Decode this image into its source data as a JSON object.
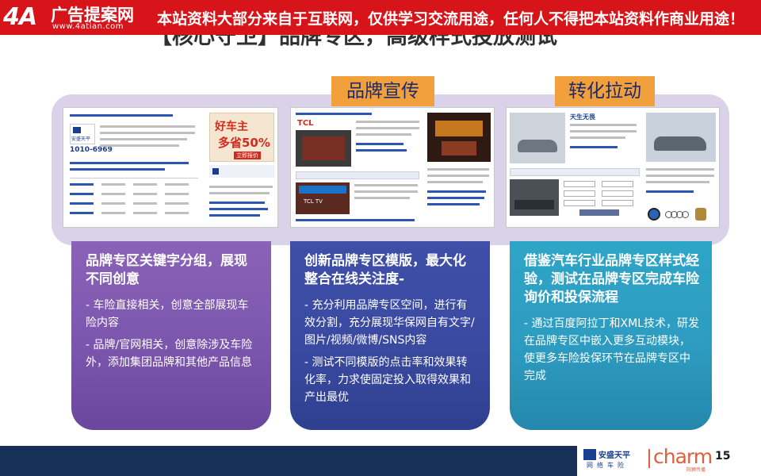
{
  "banner": {
    "logo_mark": "4A",
    "site_name": "广告提案网",
    "site_url": "www.4atian.com",
    "notice": "本站资料大部分来自于互联网，仅供学习交流用途，任何人不得把本站资料作商业用途！"
  },
  "slide": {
    "title": "【核心守卫】品牌专区，高级样式投放测试"
  },
  "tags": {
    "promo": "品牌宣传",
    "convert": "转化拉动"
  },
  "screenshots": {
    "shot1": {
      "brand": "安盛天平",
      "phone": "1010-6969",
      "promo_lines": [
        "好车主",
        "多省50%"
      ],
      "cta": "立即报价"
    },
    "shot2": {
      "brand": "TCL",
      "promo": "TCL TV"
    },
    "shot3": {
      "brand": "天生无畏",
      "car_brands": [
        "Mercedes-Benz",
        "BMW",
        "Audi"
      ]
    }
  },
  "cards": [
    {
      "heading": "品牌专区关键字分组，展现不同创意",
      "paragraphs": [
        "- 车险直接相关，创意全部展现车险内容",
        "- 品牌/官网相关，创意除涉及车险外，添加集团品牌和其他产品信息"
      ]
    },
    {
      "heading": "创新品牌专区模版，最大化整合在线关注度-",
      "paragraphs": [
        " - 充分利用品牌专区空间，进行有效分割，充分展现华保网自有文字/图片/视频/微博/SNS内容",
        "- 测试不同模版的点击率和效果转化率，力求使固定投入取得效果和产出最优"
      ]
    },
    {
      "heading": "借鉴汽车行业品牌专区样式经验，测试在品牌专区完成车险询价和投保流程",
      "paragraphs": [
        "- 通过百度阿拉丁和XML技术，研发在品牌专区中嵌入更多互动模块，使更多车险投保环节在品牌专区中完成"
      ]
    }
  ],
  "footer": {
    "company": "安盛天平",
    "company_sub": "网络车险",
    "agency": "charm",
    "agency_sub": "阳狮传播",
    "page_number": "15"
  },
  "colors": {
    "banner_red": "#d7141a",
    "tag_orange": "#f2a03c",
    "card1_purple": "#7c56ad",
    "card2_blue": "#3a4aa1",
    "card3_teal": "#2d9cc0",
    "footer_navy": "#163057",
    "charm_orange": "#e05f3c"
  }
}
